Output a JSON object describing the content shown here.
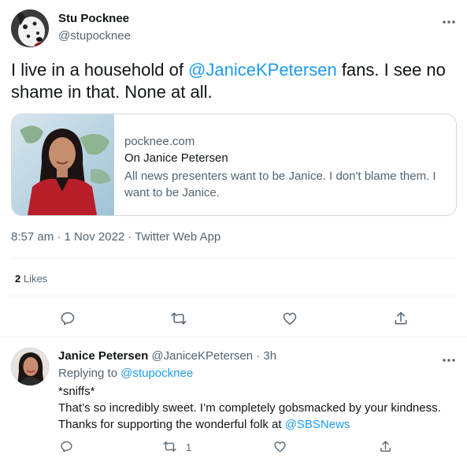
{
  "main_tweet": {
    "author_name": "Stu Pocknee",
    "author_handle": "@stupocknee",
    "text_before": "I live in a household of ",
    "mention": "@JaniceKPetersen",
    "text_after": " fans. I see no shame in that. None at all.",
    "card": {
      "domain": "pocknee.com",
      "title": "On Janice Petersen",
      "description": "All news presenters want to be Janice. I don't blame them. I want to be Janice."
    },
    "meta": "8:57 am · 1 Nov 2022 · Twitter Web App",
    "likes_count": "2",
    "likes_label": "Likes",
    "more_icon": "more-horizontal-icon"
  },
  "actions": [
    "reply-icon",
    "retweet-icon",
    "like-icon",
    "share-icon"
  ],
  "reply": {
    "author_name": "Janice Petersen",
    "author_handle": "@JaniceKPetersen",
    "time": "· 3h",
    "replying_label": "Replying to",
    "replying_to": "@stupocknee",
    "line1": "*sniffs*",
    "line2": "That’s so incredibly sweet. I’m completely gobsmacked by your kindness.",
    "line3_before": "Thanks for supporting the wonderful folk at ",
    "line3_mention": "@SBSNews",
    "retweet_count": "1"
  },
  "colors": {
    "link": "#1d9bf0",
    "muted": "#536471",
    "text": "#0f1419",
    "divider": "#eff3f4"
  }
}
